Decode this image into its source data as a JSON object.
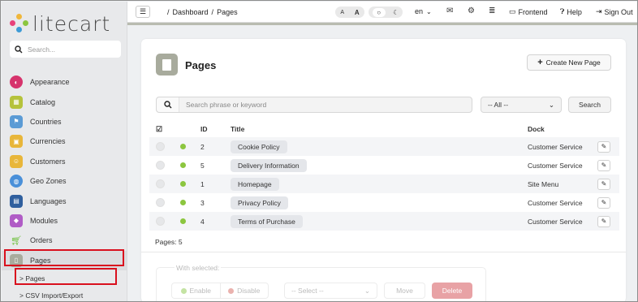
{
  "brand": {
    "name": "litecart"
  },
  "sidebar": {
    "search_placeholder": "Search...",
    "items": [
      {
        "label": "Appearance",
        "icon": "paint-icon",
        "color": "#d6336c"
      },
      {
        "label": "Catalog",
        "icon": "grid-icon",
        "color": "#b5c23b"
      },
      {
        "label": "Countries",
        "icon": "flag-icon",
        "color": "#5b9bd5"
      },
      {
        "label": "Currencies",
        "icon": "money-icon",
        "color": "#e8b63a"
      },
      {
        "label": "Customers",
        "icon": "user-icon",
        "color": "#e8b63a"
      },
      {
        "label": "Geo Zones",
        "icon": "globe-icon",
        "color": "#4a90d9"
      },
      {
        "label": "Languages",
        "icon": "chat-icon",
        "color": "#2f5f9e"
      },
      {
        "label": "Modules",
        "icon": "cube-icon",
        "color": "#b05cc6"
      },
      {
        "label": "Orders",
        "icon": "cart-icon",
        "color": "#6cbf3a"
      },
      {
        "label": "Pages",
        "icon": "file-icon",
        "color": "#a8ab9d"
      }
    ],
    "subitems": [
      {
        "label": "> Pages"
      },
      {
        "label": "> CSV Import/Export"
      }
    ]
  },
  "topbar": {
    "breadcrumb": [
      "/",
      "Dashboard",
      "/",
      "Pages"
    ],
    "font_small": "A",
    "font_large": "A",
    "language": "en",
    "frontend": "Frontend",
    "help": "Help",
    "signout": "Sign Out"
  },
  "main": {
    "title": "Pages",
    "create_button": "Create New Page",
    "search_placeholder": "Search phrase or keyword",
    "filter_value": "-- All --",
    "search_button": "Search",
    "columns": {
      "id": "ID",
      "title": "Title",
      "dock": "Dock"
    },
    "rows": [
      {
        "id": "2",
        "title": "Cookie Policy",
        "dock": "Customer Service"
      },
      {
        "id": "5",
        "title": "Delivery Information",
        "dock": "Customer Service"
      },
      {
        "id": "1",
        "title": "Homepage",
        "dock": "Site Menu"
      },
      {
        "id": "3",
        "title": "Privacy Policy",
        "dock": "Customer Service"
      },
      {
        "id": "4",
        "title": "Terms of Purchase",
        "dock": "Customer Service"
      }
    ],
    "footer": "Pages: 5",
    "with_selected": {
      "legend": "With selected:",
      "enable": "Enable",
      "disable": "Disable",
      "select_placeholder": "-- Select --",
      "move": "Move",
      "delete": "Delete"
    }
  },
  "colors": {
    "accent": "#a8ab9d",
    "status_enabled": "#8cc63f",
    "highlight": "#d9101e",
    "delete": "#e8a2a5"
  }
}
